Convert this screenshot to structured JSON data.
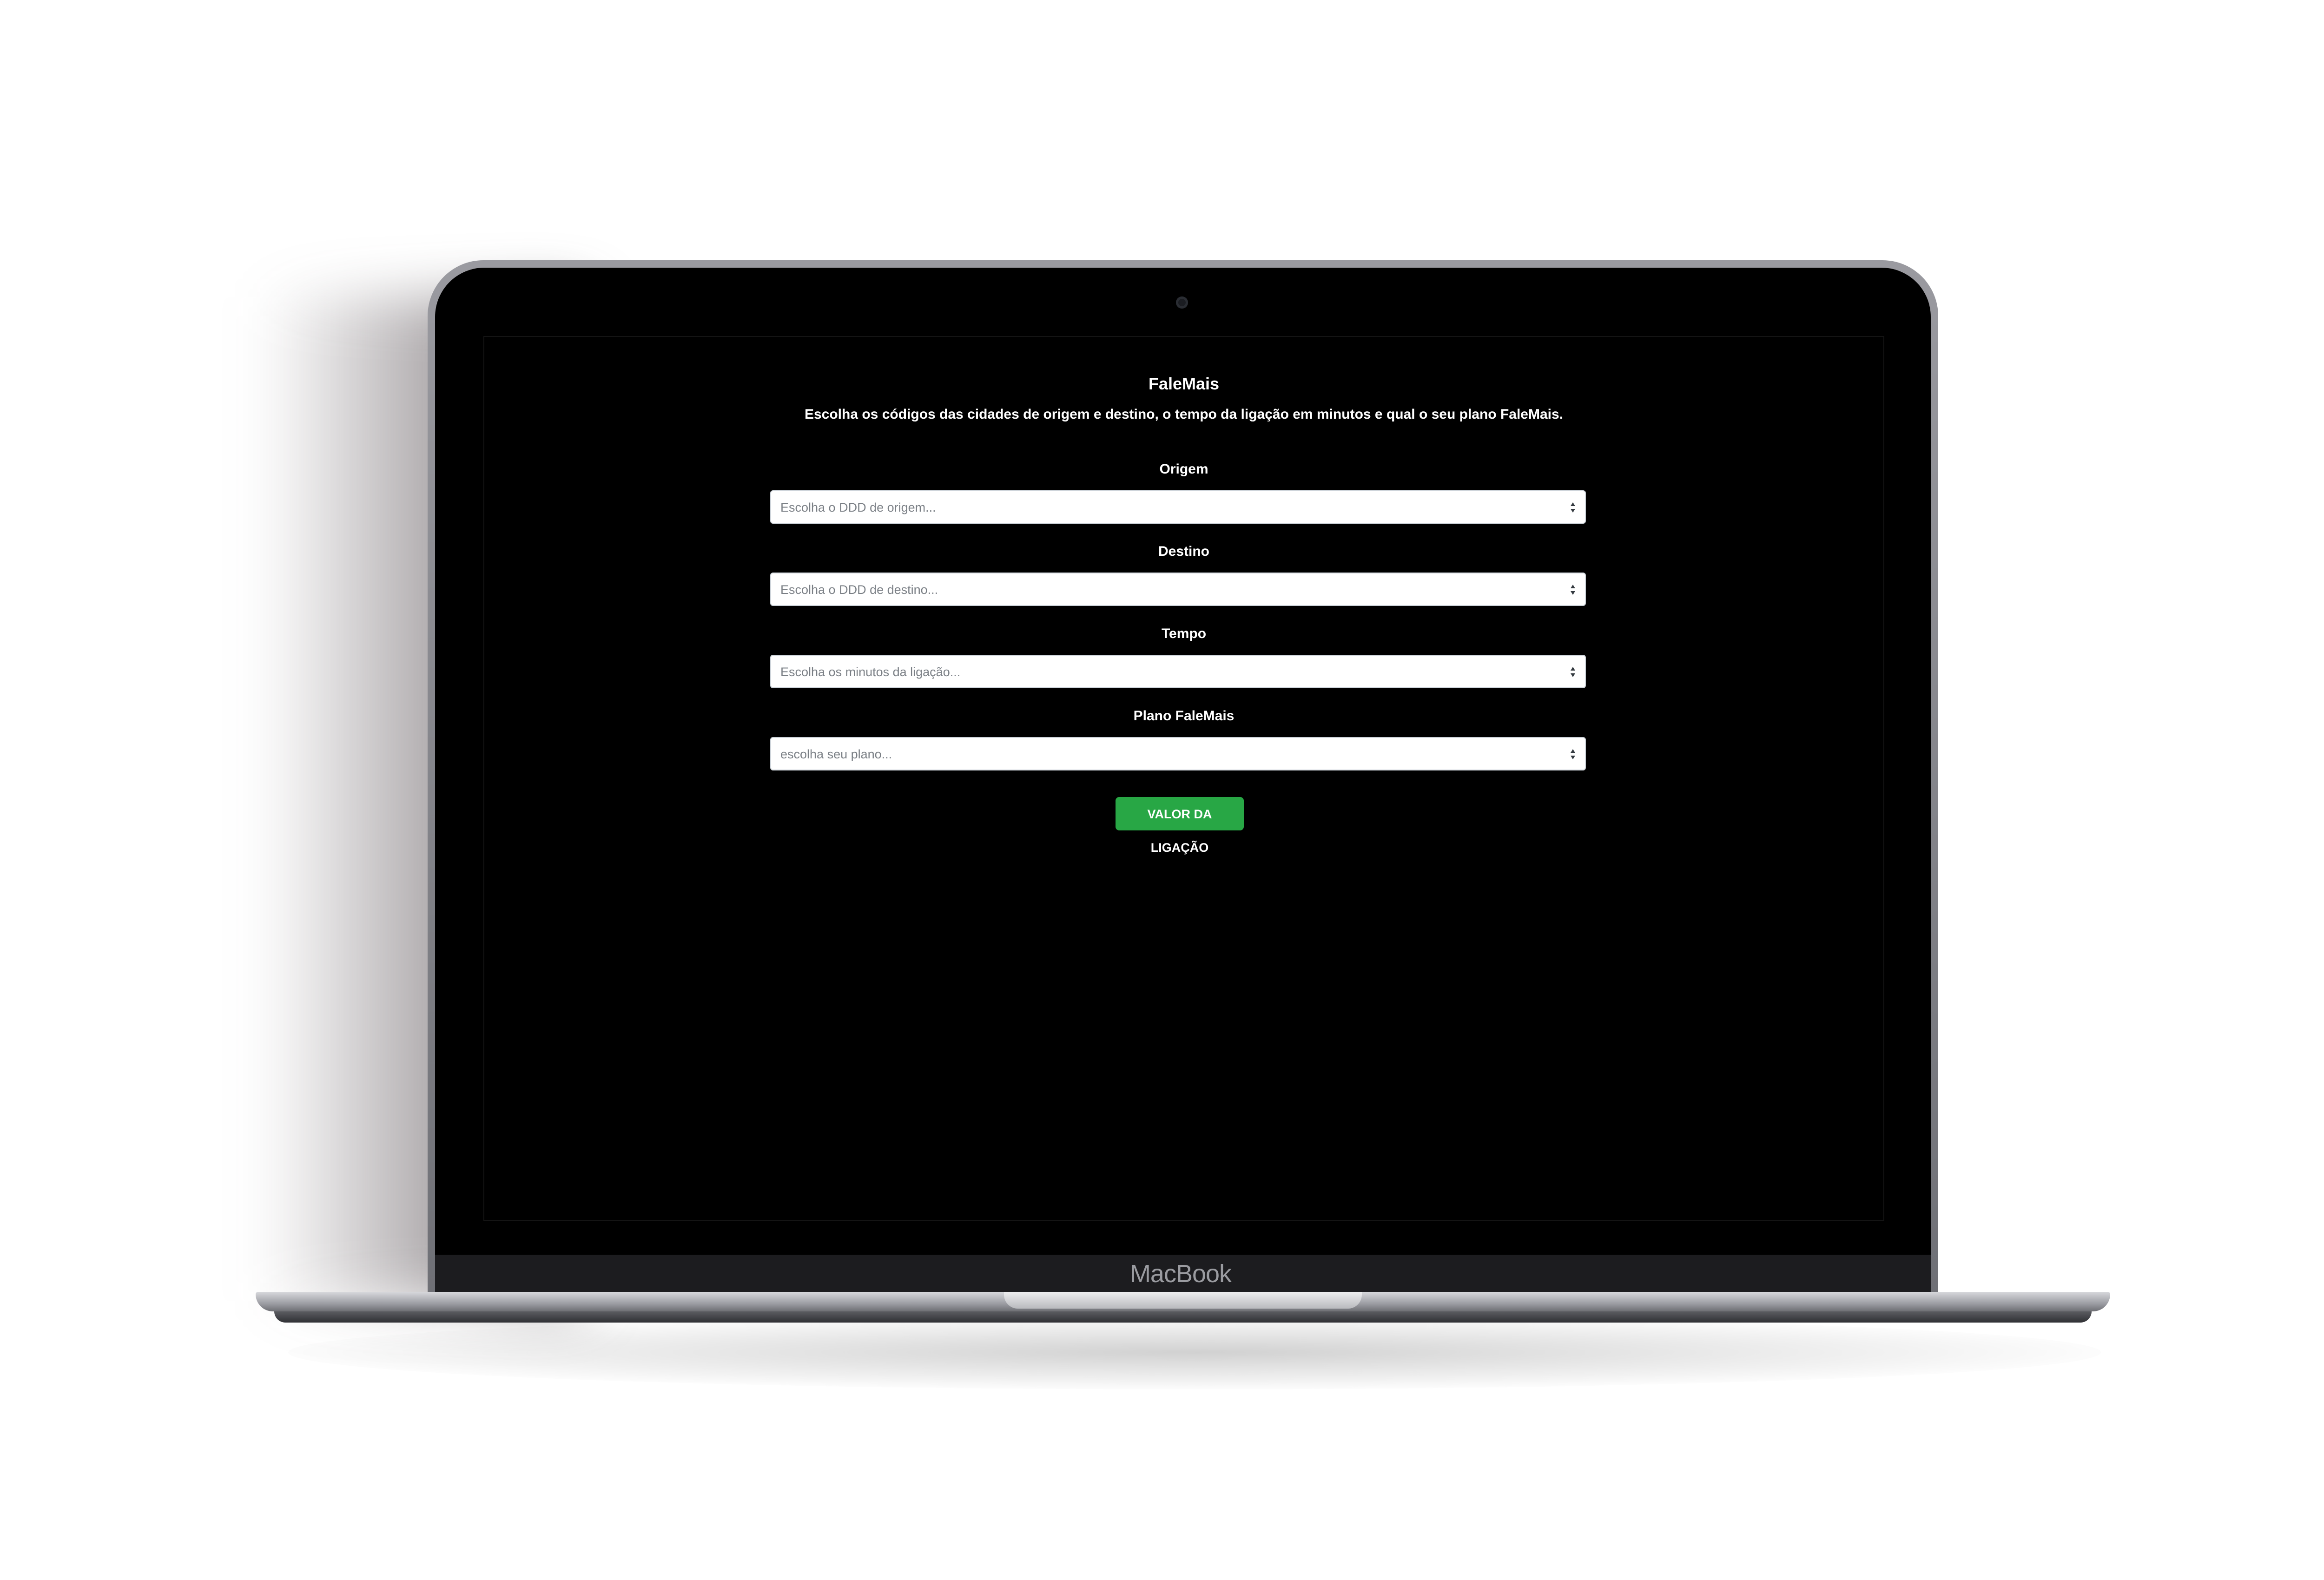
{
  "device": {
    "brand_label": "MacBook"
  },
  "app": {
    "title": "FaleMais",
    "subtitle": "Escolha os códigos das cidades de origem e destino, o tempo da ligação em minutos e qual o seu plano FaleMais."
  },
  "form": {
    "fields": [
      {
        "label": "Origem",
        "placeholder": "Escolha o DDD de origem..."
      },
      {
        "label": "Destino",
        "placeholder": "Escolha o DDD de destino..."
      },
      {
        "label": "Tempo",
        "placeholder": "Escolha os minutos da ligação..."
      },
      {
        "label": "Plano FaleMais",
        "placeholder": "escolha seu plano..."
      }
    ],
    "submit_label": "VALOR DA LIGAÇÃO"
  },
  "colors": {
    "screen_background": "#000000",
    "button_green": "#28a745",
    "text_white": "#ffffff"
  }
}
